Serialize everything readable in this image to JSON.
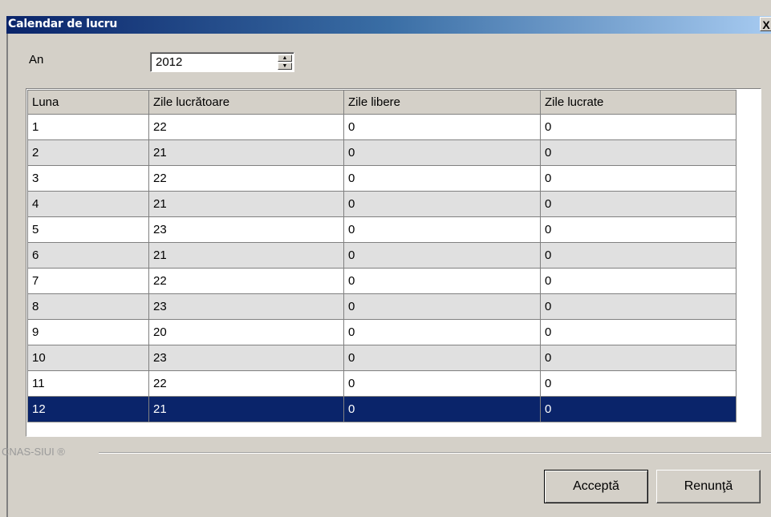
{
  "window": {
    "title": "Calendar de lucru",
    "close_label": "X"
  },
  "year": {
    "label": "An",
    "value": "2012"
  },
  "grid": {
    "columns": [
      "Luna",
      "Zile lucrătoare",
      "Zile libere",
      "Zile lucrate"
    ],
    "rows": [
      [
        "1",
        "22",
        "0",
        "0"
      ],
      [
        "2",
        "21",
        "0",
        "0"
      ],
      [
        "3",
        "22",
        "0",
        "0"
      ],
      [
        "4",
        "21",
        "0",
        "0"
      ],
      [
        "5",
        "23",
        "0",
        "0"
      ],
      [
        "6",
        "21",
        "0",
        "0"
      ],
      [
        "7",
        "22",
        "0",
        "0"
      ],
      [
        "8",
        "23",
        "0",
        "0"
      ],
      [
        "9",
        "20",
        "0",
        "0"
      ],
      [
        "10",
        "23",
        "0",
        "0"
      ],
      [
        "11",
        "22",
        "0",
        "0"
      ],
      [
        "12",
        "21",
        "0",
        "0"
      ]
    ],
    "selected_row_index": 11
  },
  "footer": {
    "brand": "CNAS-SIUI ®",
    "accept_label": "Acceptă",
    "cancel_label": "Renunţă"
  },
  "colors": {
    "selection": "#0a246a",
    "title_start": "#0a246a",
    "title_end": "#a6caf0",
    "alt_row": "#e0e0e0"
  }
}
